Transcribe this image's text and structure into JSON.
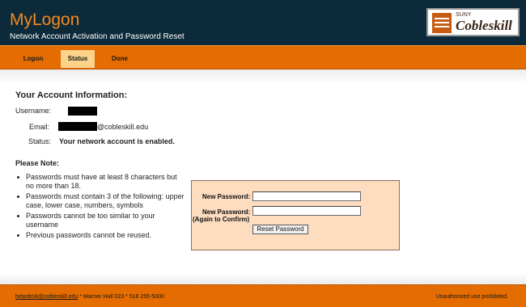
{
  "header": {
    "app_title": "MyLogon",
    "subtitle": "Network Account Activation and Password Reset",
    "logo_prefix": "SUNY",
    "logo_name": "Cobleskill"
  },
  "nav": {
    "tabs": [
      {
        "label": "Logon",
        "active": false
      },
      {
        "label": "Status",
        "active": true
      },
      {
        "label": "Done",
        "active": false
      }
    ]
  },
  "account": {
    "title": "Your Account Information:",
    "username_label": "Username:",
    "email_label": "Email:",
    "email_domain": "@cobleskill.edu",
    "status_label": "Status:",
    "status_value": "Your network account is enabled."
  },
  "notes": {
    "title": "Please Note:",
    "items": [
      "Passwords must have at least 8 characters but no more than 18.",
      "Passwords must contain 3 of the following: upper case, lower case, numbers, symbols",
      "Passwords cannot be too similar to your username",
      "Previous passwords cannot be reused."
    ]
  },
  "reset_form": {
    "new_password_label": "New Password:",
    "confirm_label_line1": "New Password:",
    "confirm_label_line2": "(Again to Confirm)",
    "submit_label": "Reset Password"
  },
  "footer": {
    "email_link": "helpdesk@cobleskill.edu",
    "contact": " * Warner Hall 023 * 518 255-5000",
    "notice": "Unauthorized use prohibited."
  },
  "colors": {
    "header_bg": "#0c2a3a",
    "accent": "#e46c00",
    "title_orange": "#f48a1c",
    "active_tab": "#fbd38a",
    "form_bg": "#fddcc0"
  }
}
